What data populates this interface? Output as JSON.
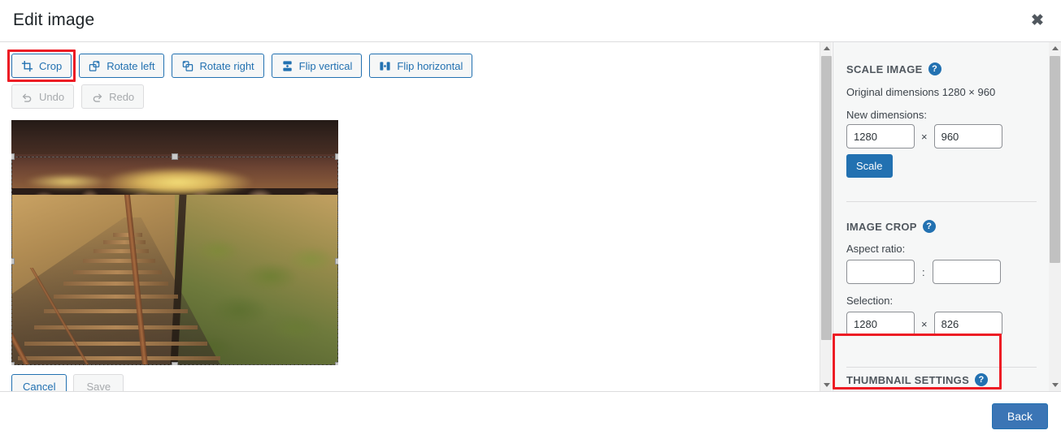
{
  "header": {
    "title": "Edit image",
    "close_label": "✖"
  },
  "toolbar": {
    "row1": [
      {
        "label": "Crop",
        "icon": "crop-icon",
        "disabled": false,
        "highlighted": true
      },
      {
        "label": "Rotate left",
        "icon": "rotate-left-icon",
        "disabled": false,
        "highlighted": false
      },
      {
        "label": "Rotate right",
        "icon": "rotate-right-icon",
        "disabled": false,
        "highlighted": false
      },
      {
        "label": "Flip vertical",
        "icon": "flip-vertical-icon",
        "disabled": false,
        "highlighted": false
      },
      {
        "label": "Flip horizontal",
        "icon": "flip-horizontal-icon",
        "disabled": false,
        "highlighted": false
      }
    ],
    "row2": [
      {
        "label": "Undo",
        "icon": "undo-icon",
        "disabled": true
      },
      {
        "label": "Redo",
        "icon": "redo-icon",
        "disabled": true
      }
    ]
  },
  "image_actions": {
    "cancel_label": "Cancel",
    "save_label": "Save"
  },
  "sidebar": {
    "scale": {
      "heading": "SCALE IMAGE",
      "help_glyph": "?",
      "original_dimensions": "Original dimensions 1280 × 960",
      "new_dimensions_label": "New dimensions:",
      "width_value": "1280",
      "height_value": "960",
      "separator": "×",
      "scale_button": "Scale"
    },
    "crop": {
      "heading": "IMAGE CROP",
      "help_glyph": "?",
      "aspect_label": "Aspect ratio:",
      "aspect_width_value": "",
      "aspect_height_value": "",
      "aspect_separator": ":",
      "selection_label": "Selection:",
      "selection_width_value": "1280",
      "selection_height_value": "826",
      "selection_separator": "×"
    },
    "thumbnail": {
      "heading": "THUMBNAIL SETTINGS",
      "help_glyph": "?"
    }
  },
  "footer": {
    "back_label": "Back"
  },
  "colors": {
    "accent": "#2271b1",
    "back_button": "#3b75b5",
    "annotation": "#ed1c24",
    "sidebar_bg": "#f6f7f7",
    "text": "#3c434a",
    "muted": "#a7aaad"
  }
}
